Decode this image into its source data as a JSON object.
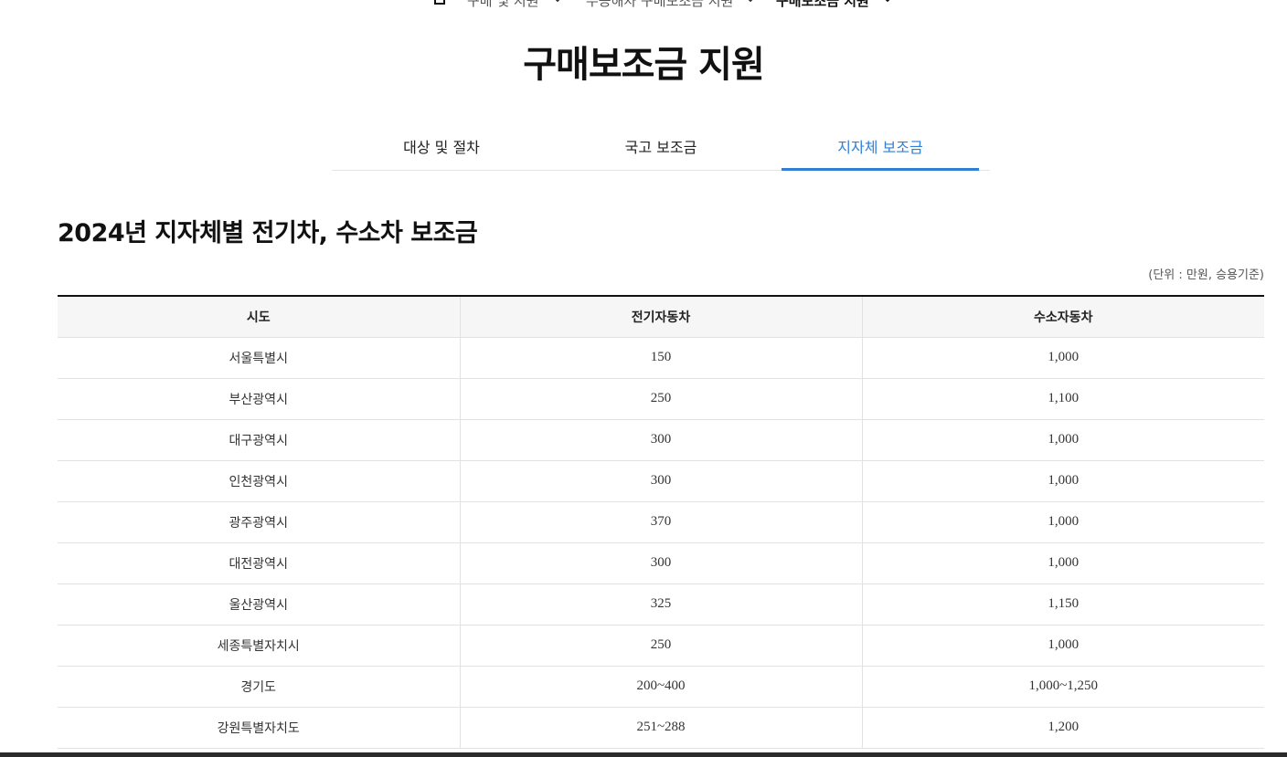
{
  "breadcrumb": {
    "items": [
      {
        "label": "구매 및 지원"
      },
      {
        "label": "무공해차 구매보조금 지원"
      },
      {
        "label": "구매보조금 지원"
      }
    ]
  },
  "page_title": "구매보조금 지원",
  "tabs": [
    {
      "label": "대상 및 절차",
      "active": false
    },
    {
      "label": "국고 보조금",
      "active": false
    },
    {
      "label": "지자체 보조금",
      "active": true
    }
  ],
  "section": {
    "title": "2024년 지자체별 전기차, 수소차 보조금",
    "unit_note": "(단위 : 만원, 승용기준)"
  },
  "table": {
    "headers": [
      "시도",
      "전기자동차",
      "수소자동차"
    ],
    "rows": [
      [
        "서울특별시",
        "150",
        "1,000"
      ],
      [
        "부산광역시",
        "250",
        "1,100"
      ],
      [
        "대구광역시",
        "300",
        "1,000"
      ],
      [
        "인천광역시",
        "300",
        "1,000"
      ],
      [
        "광주광역시",
        "370",
        "1,000"
      ],
      [
        "대전광역시",
        "300",
        "1,000"
      ],
      [
        "울산광역시",
        "325",
        "1,150"
      ],
      [
        "세종특별자치시",
        "250",
        "1,000"
      ],
      [
        "경기도",
        "200~400",
        "1,000~1,250"
      ],
      [
        "강원특별자치도",
        "251~288",
        "1,200"
      ]
    ]
  },
  "colors": {
    "accent": "#2f7fd6",
    "header_bg": "#f6f6f6",
    "border": "#e2e2e2"
  }
}
